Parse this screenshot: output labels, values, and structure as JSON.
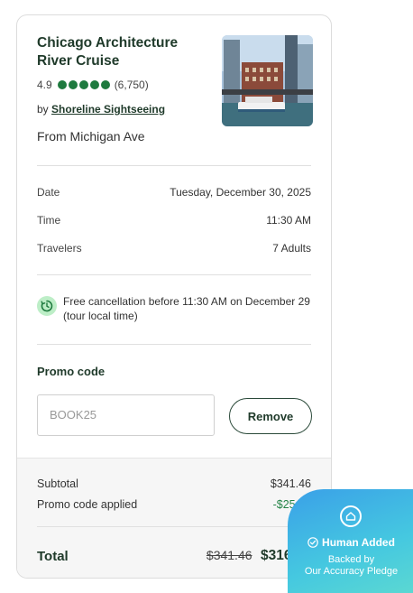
{
  "tour": {
    "title": "Chicago Architecture River Cruise",
    "rating": "4.9",
    "review_count": "(6,750)",
    "bubbles": 5,
    "by_prefix": "by",
    "operator": "Shoreline Sightseeing",
    "from": "From Michigan Ave"
  },
  "details": [
    {
      "label": "Date",
      "value": "Tuesday, December 30, 2025"
    },
    {
      "label": "Time",
      "value": "11:30 AM"
    },
    {
      "label": "Travelers",
      "value": "7 Adults"
    }
  ],
  "cancellation": {
    "text": "Free cancellation before 11:30 AM on December 29 (tour local time)"
  },
  "promo": {
    "title": "Promo code",
    "value": "BOOK25",
    "remove_label": "Remove"
  },
  "summary": {
    "subtotal_label": "Subtotal",
    "subtotal_value": "$341.46",
    "promo_label": "Promo code applied",
    "promo_value": "-$25.00",
    "total_label": "Total",
    "total_old": "$341.46",
    "total_new": "$316.46"
  },
  "badge": {
    "main": "Human Added",
    "sub1": "Backed by",
    "sub2": "Our Accuracy Pledge"
  },
  "colors": {
    "brand_green": "#1e7a3e",
    "discount_green": "#238346",
    "badge_blue": "#3aa0e8"
  }
}
